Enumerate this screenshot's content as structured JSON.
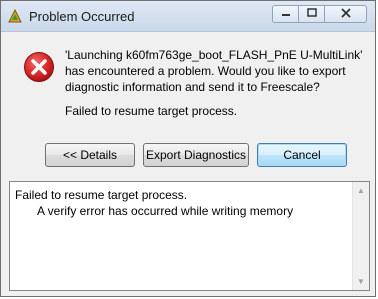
{
  "window": {
    "title": "Problem Occurred",
    "controls": [
      "minimize",
      "maximize",
      "close"
    ]
  },
  "message": {
    "icon": "error-icon",
    "text": "'Launching k60fm763ge_boot_FLASH_PnE U-MultiLink' has encountered a problem. Would you like to export diagnostic information and send it to Freescale?",
    "sub_text": "Failed to resume target process."
  },
  "buttons": {
    "details_label": "<< Details",
    "export_label": "Export Diagnostics",
    "cancel_label": "Cancel"
  },
  "details": {
    "line1": "Failed to resume target process.",
    "line2": "A verify error has occurred while writing memory"
  },
  "colors": {
    "error_red": "#d62828",
    "default_button_border": "#3c7fb1",
    "dialog_bg": "#f0f0f0"
  }
}
